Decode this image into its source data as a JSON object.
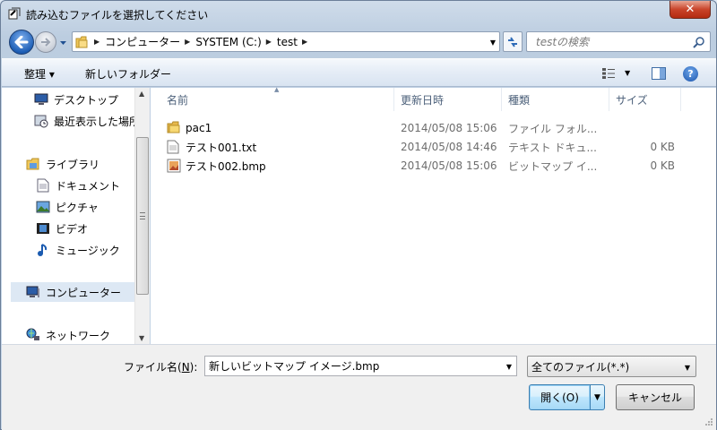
{
  "window": {
    "title": "読み込むファイルを選択してください",
    "close_label": "✕"
  },
  "nav": {
    "breadcrumbs": [
      "コンピューター",
      "SYSTEM (C:)",
      "test"
    ],
    "search_placeholder": "testの検索"
  },
  "toolbar": {
    "organize_label": "整理 ▾",
    "new_folder_label": "新しいフォルダー"
  },
  "sidebar": {
    "items": [
      {
        "label": "デスクトップ",
        "icon": "desktop-icon"
      },
      {
        "label": "最近表示した場所",
        "icon": "recent-places-icon"
      },
      {
        "label": "ライブラリ",
        "icon": "library-icon"
      },
      {
        "label": "ドキュメント",
        "icon": "documents-icon"
      },
      {
        "label": "ピクチャ",
        "icon": "pictures-icon"
      },
      {
        "label": "ビデオ",
        "icon": "videos-icon"
      },
      {
        "label": "ミュージック",
        "icon": "music-icon"
      },
      {
        "label": "コンピューター",
        "icon": "computer-icon"
      },
      {
        "label": "ネットワーク",
        "icon": "network-icon"
      }
    ]
  },
  "columns": {
    "name": "名前",
    "date": "更新日時",
    "type": "種類",
    "size": "サイズ"
  },
  "files": [
    {
      "name": "pac1",
      "date": "2014/05/08 15:06",
      "type": "ファイル フォル...",
      "size": "",
      "icon": "folder-icon"
    },
    {
      "name": "テスト001.txt",
      "date": "2014/05/08 14:46",
      "type": "テキスト ドキュ...",
      "size": "0 KB",
      "icon": "text-file-icon"
    },
    {
      "name": "テスト002.bmp",
      "date": "2014/05/08 15:06",
      "type": "ビットマップ イ...",
      "size": "0 KB",
      "icon": "bitmap-file-icon"
    }
  ],
  "footer": {
    "filename_label_prefix": "ファイル名(",
    "filename_label_key": "N",
    "filename_label_suffix": "):",
    "filename_value": "新しいビットマップ イメージ.bmp",
    "filter_value": "全てのファイル(*.*)",
    "open_label": "開く(O)",
    "cancel_label": "キャンセル"
  }
}
